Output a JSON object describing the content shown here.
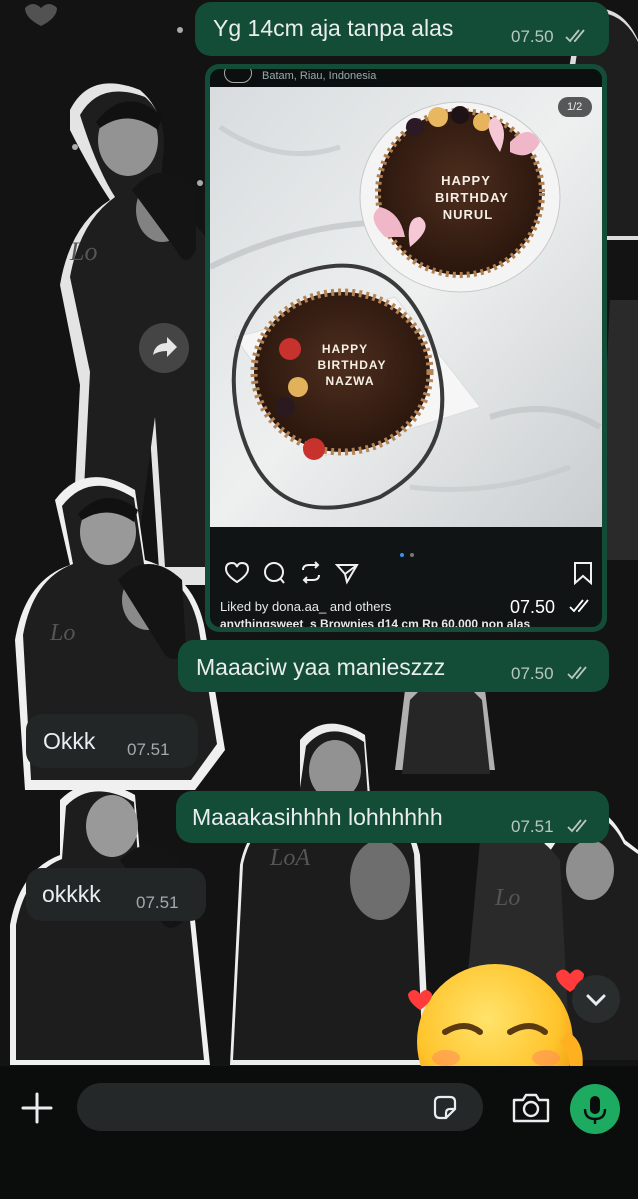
{
  "messages": [
    {
      "text": "Yg 14cm aja tanpa alas",
      "time": "07.50",
      "direction": "out",
      "status": "read"
    },
    {
      "type": "image",
      "caption_location": "Batam, Riau, Indonesia",
      "counter": "1/2",
      "cake_top": "HAPPY BIRTHDAY NURUL",
      "cake_bottom": "HAPPY BIRTHDAY NAZWA",
      "liked_by": "Liked by dona.aa_ and others",
      "caption": "anythingsweet_s Brownies d14 cm Rp 60.000 non alas",
      "time": "07.50",
      "direction": "out",
      "status": "read"
    },
    {
      "text": "Maaaciw yaa manieszzz",
      "time": "07.50",
      "direction": "out",
      "status": "read"
    },
    {
      "text": "Okkk",
      "time": "07.51",
      "direction": "in"
    },
    {
      "text": "Maaakasihhhh lohhhhhh",
      "time": "07.51",
      "direction": "out",
      "status": "read"
    },
    {
      "text": "okkkk",
      "time": "07.51",
      "direction": "in"
    }
  ],
  "icons": {
    "forward": "forward-icon",
    "scroll_down": "chevron-down-icon",
    "attach": "plus-icon",
    "sticker": "sticker-icon",
    "camera": "camera-icon",
    "mic": "microphone-icon",
    "emoji": "relieved-face-emoji"
  },
  "colors": {
    "outgoing_bubble": "#144d37",
    "incoming_bubble": "#232626",
    "mic_button": "#1daa61",
    "text": "#e9edef"
  }
}
